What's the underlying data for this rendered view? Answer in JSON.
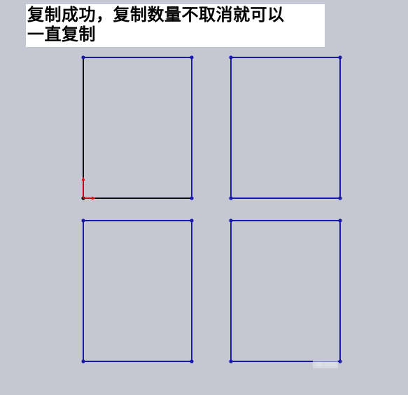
{
  "caption": {
    "line1": "复制成功，复制数量不取消就可以",
    "line2": "一直复制"
  },
  "sketch": {
    "rectangle_count": 4,
    "layout": "2x2 grid",
    "colors": {
      "background": "#c5c8d3",
      "line": "#1a1aa8",
      "original_edge": "#111111",
      "origin_axis": "#e01010"
    }
  },
  "icons": [
    "origin-axis-icon",
    "watermark-icon"
  ]
}
